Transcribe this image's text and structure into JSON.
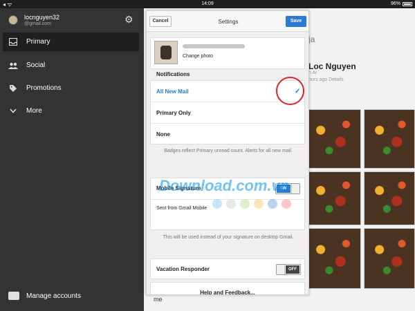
{
  "statusbar": {
    "signal": "◂ ᯤ",
    "time": "14:09",
    "battery": "96%"
  },
  "sidebar": {
    "account": {
      "name": "locnguyen32",
      "email": "@gmail.com"
    },
    "items": [
      {
        "label": "Primary",
        "icon": "inbox-icon",
        "active": true
      },
      {
        "label": "Social",
        "icon": "people-icon",
        "active": false
      },
      {
        "label": "Promotions",
        "icon": "tag-icon",
        "active": false
      },
      {
        "label": "More",
        "icon": "chevron-down-icon",
        "active": false
      }
    ],
    "manage_accounts": "Manage accounts"
  },
  "background": {
    "name": "Loc Nguyen",
    "partial_title": "ja",
    "meta1": "h Ai",
    "meta2": "ours ago  Details",
    "bottom_sender": "me"
  },
  "settings": {
    "cancel_label": "Cancel",
    "title": "Settings",
    "save_label": "Save",
    "change_photo": "Change photo",
    "notifications_title": "Notifications",
    "notification_options": [
      {
        "label": "All New Mail",
        "selected": true
      },
      {
        "label": "Primary Only",
        "selected": false
      },
      {
        "label": "None",
        "selected": false
      }
    ],
    "badges_help": "Badges reflect Primary unread count. Alerts for all new mail.",
    "mobile_signature_label": "Mobile Signature",
    "mobile_signature_state": "ON",
    "signature_text": "Sent from Gmail Mobile",
    "signature_colors": [
      "#9fd3f5",
      "#d9d9d9",
      "#c8e6a8",
      "#f7d28a",
      "#8ab6e6",
      "#f2a3a3"
    ],
    "signature_help": "This will be used instead of your signature on desktop Gmail.",
    "vacation_label": "Vacation Responder",
    "vacation_state": "OFF",
    "help_feedback": "Help and Feedback..."
  },
  "watermark": "Download.com.vn",
  "colors": {
    "accent": "#2a7ad6",
    "highlight_ring": "#d9242e",
    "sidebar_bg": "#333333"
  }
}
